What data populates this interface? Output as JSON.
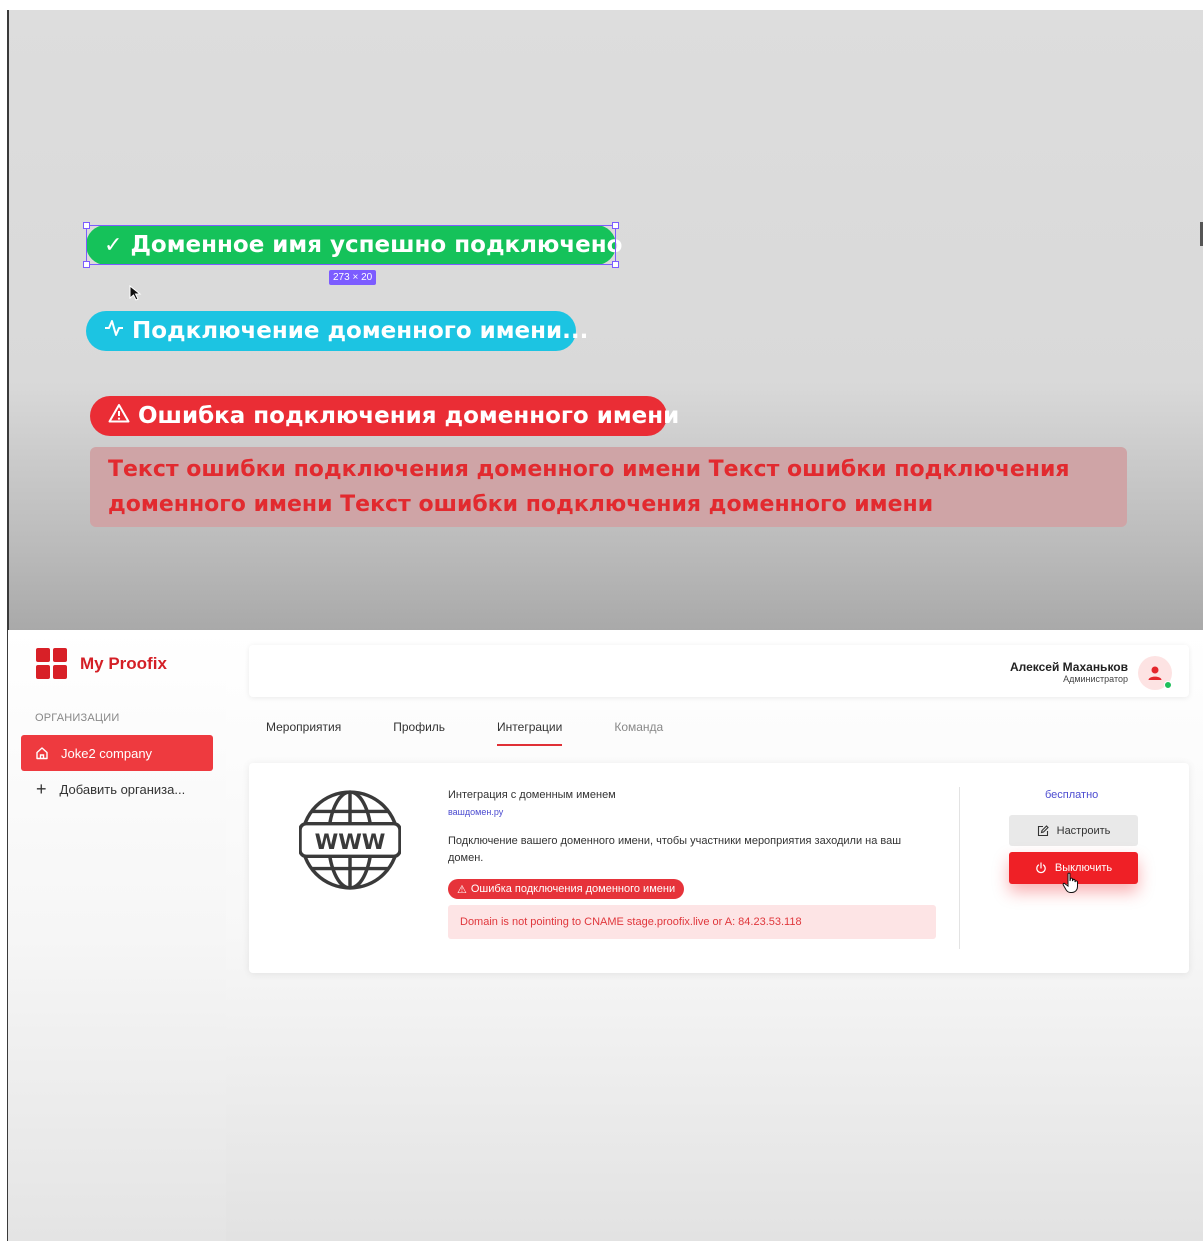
{
  "design_canvas": {
    "success_pill": {
      "icon": "check-icon",
      "text": "Доменное имя успешно подключено",
      "color": "#15c25a"
    },
    "connecting_pill": {
      "icon": "activity-icon",
      "text": "Подключение доменного имени...",
      "color": "#1cc4e2"
    },
    "error_pill": {
      "icon": "warning-icon",
      "text": "Ошибка подключения доменного имени",
      "color": "#ea2d35"
    },
    "size_badge": "273 × 20",
    "error_text": "Текст ошибки подключения доменного имени Текст ошибки подключения доменного имени Текст ошибки подключения доменного имени"
  },
  "sidebar": {
    "brand": "My Proofix",
    "section_heading": "ОРГАНИЗАЦИИ",
    "active_org": "Joke2 company",
    "add_org": "Добавить организа..."
  },
  "header": {
    "user_name": "Алексей Маханьков",
    "user_role": "Администратор"
  },
  "tabs": [
    {
      "label": "Мероприятия"
    },
    {
      "label": "Профиль"
    },
    {
      "label": "Интеграции",
      "active": true
    },
    {
      "label": "Команда"
    }
  ],
  "integration": {
    "title": "Интеграция с доменным именем",
    "domain": "вашдомен.ру",
    "description": "Подключение вашего доменного имени, чтобы участники мероприятия заходили на ваш домен.",
    "status_badge": "Ошибка подключения доменного имени",
    "error_message": "Domain is not pointing to CNAME stage.proofix.live or A: 84.23.53.118",
    "price": "бесплатно",
    "setup_button": "Настроить",
    "disable_button": "Выключить"
  },
  "colors": {
    "brand_red": "#d41f26",
    "accent_red": "#ef2026",
    "link_blue": "#4b4bd0"
  }
}
